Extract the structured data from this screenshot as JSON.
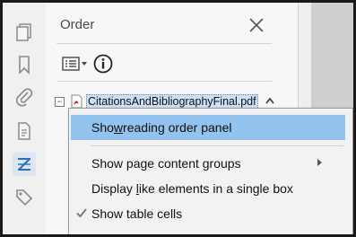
{
  "panel": {
    "title": "Order",
    "close_icon": "close-icon",
    "options_icon": "options-list-icon",
    "info_icon": "info-icon"
  },
  "sidebar": {
    "icons": [
      "pages-icon",
      "bookmark-icon",
      "attachment-icon",
      "content-icon",
      "order-icon",
      "tags-icon"
    ],
    "active": "order-icon"
  },
  "tree": {
    "expander": "−",
    "document_label": "CitationsAndBibliographyFinal.pdf"
  },
  "menu": {
    "items": [
      {
        "label_before": "Sho",
        "underline": "w",
        "label_after": " reading order panel",
        "highlighted": true,
        "checked": false,
        "submenu": false
      },
      {
        "label_before": "Show page content groups",
        "underline": "",
        "label_after": "",
        "highlighted": false,
        "checked": false,
        "submenu": true
      },
      {
        "label_before": "Display ",
        "underline": "l",
        "label_after": "ike elements in a single box",
        "highlighted": false,
        "checked": false,
        "submenu": false
      },
      {
        "label_before": "Show table cells",
        "underline": "",
        "label_after": "",
        "highlighted": false,
        "checked": true,
        "submenu": false
      }
    ]
  },
  "colors": {
    "highlight": "#93c3ef",
    "active_icon": "#2f6db5",
    "icon_gray": "#8a8a8a"
  }
}
